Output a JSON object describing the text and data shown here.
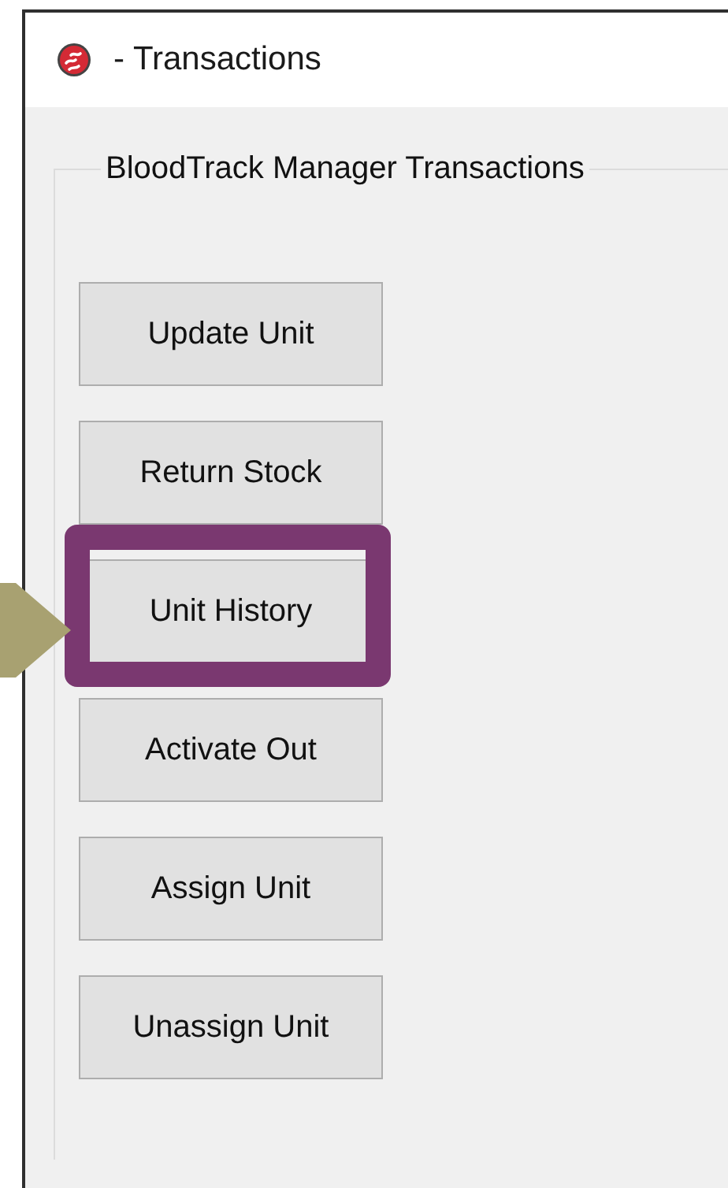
{
  "window": {
    "title": "- Transactions"
  },
  "group": {
    "label": "BloodTrack Manager Transactions"
  },
  "buttons": [
    {
      "label": "Update Unit",
      "highlighted": false
    },
    {
      "label": "Return Stock",
      "highlighted": false
    },
    {
      "label": "Unit History",
      "highlighted": true
    },
    {
      "label": "Activate Out",
      "highlighted": false
    },
    {
      "label": "Assign Unit",
      "highlighted": false
    },
    {
      "label": "Unassign Unit",
      "highlighted": false
    }
  ]
}
